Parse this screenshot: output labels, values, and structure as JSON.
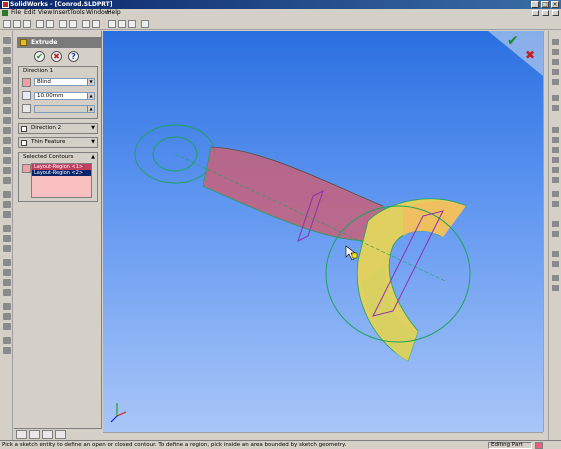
{
  "window": {
    "title": "SolidWorks - [Conrod.SLDPRT]",
    "controls": [
      "_",
      "□",
      "×"
    ]
  },
  "menu": {
    "items": [
      "File",
      "Edit",
      "View",
      "Insert",
      "Tools",
      "Window",
      "Help"
    ]
  },
  "property_manager": {
    "title": "Extrude",
    "ok_glyph": "✔",
    "cancel_glyph": "✖",
    "help_glyph": "?",
    "direction1": {
      "label": "Direction 1",
      "end_condition": "Blind",
      "depth": "10.00mm"
    },
    "direction2": {
      "label": "Direction 2"
    },
    "thin_feature": {
      "label": "Thin Feature"
    },
    "selected_contours": {
      "label": "Selected Contours",
      "items": [
        "Layout-Region <1>",
        "Layout-Region <2>"
      ]
    }
  },
  "status_bar": {
    "message": "Pick a sketch entity to define an open or closed contour.  To define a region, pick inside an area bounded by sketch geometry.",
    "mode": "Editing Part"
  },
  "colors": {
    "title_bar": "#0a246a",
    "viewport_top": "#2a6fe0",
    "viewport_bottom": "#a9c6f7",
    "sketch": "#1ca35a",
    "preview_face": "#c8607a",
    "solid_face": "#e0d060"
  }
}
